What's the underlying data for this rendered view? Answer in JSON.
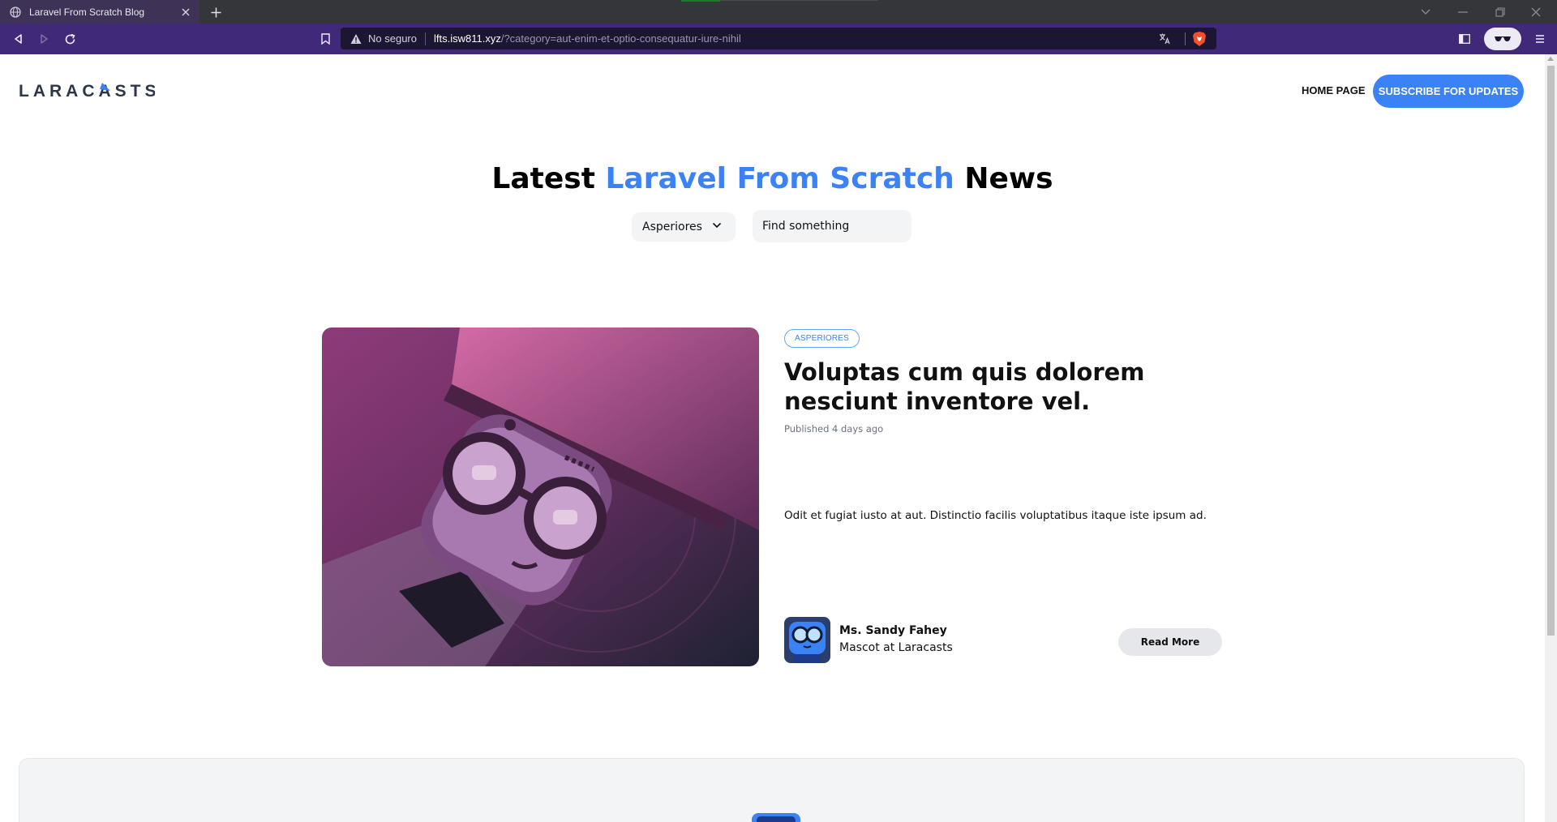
{
  "browser": {
    "tab_title": "Laravel From Scratch Blog",
    "security_label": "No seguro",
    "url_host": "lfts.isw811.xyz",
    "url_path": "/?category=aut-enim-et-optio-consequatur-iure-nihil",
    "accent_color": "#41297a"
  },
  "header": {
    "logo_text": "LARACASTS",
    "home_link": "HOME PAGE",
    "subscribe_button": "SUBSCRIBE FOR UPDATES"
  },
  "hero": {
    "title_prefix": "Latest ",
    "title_accent": "Laravel From Scratch",
    "title_suffix": " News",
    "category_selected": "Asperiores",
    "search_placeholder": "Find something"
  },
  "post": {
    "category_badge": "ASPERIORES",
    "title": "Voluptas cum quis dolorem nesciunt inventore vel.",
    "published": "Published 4 days ago",
    "excerpt": "Odit et fugiat iusto at aut. Distinctio facilis voluptatibus itaque iste ipsum ad.",
    "author_name": "Ms. Sandy Fahey",
    "author_role": "Mascot at Laracasts",
    "read_more": "Read More"
  },
  "colors": {
    "brand_blue": "#3b82f6",
    "text": "#111111",
    "muted": "#6b7280"
  }
}
